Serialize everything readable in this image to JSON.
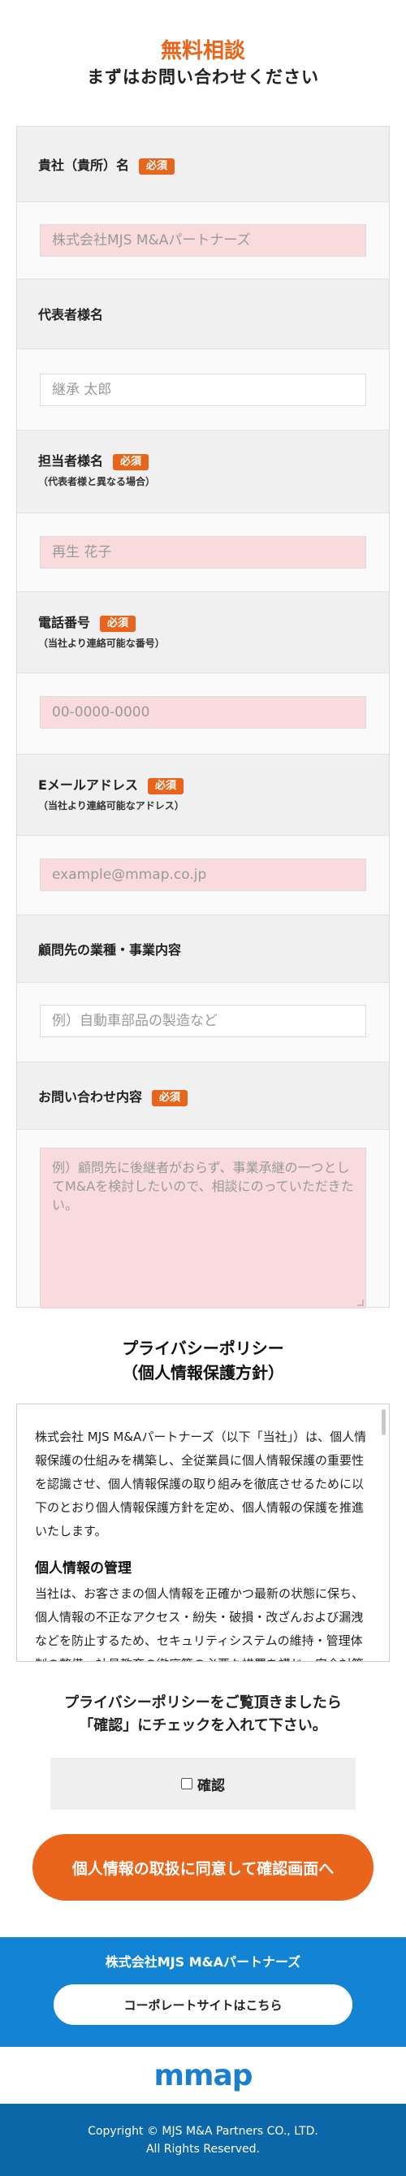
{
  "header": {
    "title": "無料相談",
    "subtitle": "まずはお問い合わせください"
  },
  "required_label": "必須",
  "form": {
    "company": {
      "label": "貴社（貴所）名",
      "placeholder": "株式会社MJS M&Aパートナーズ"
    },
    "representative": {
      "label": "代表者様名",
      "placeholder": "継承 太郎"
    },
    "contact_person": {
      "label": "担当者様名",
      "sublabel": "（代表者様と異なる場合）",
      "placeholder": "再生 花子"
    },
    "phone": {
      "label": "電話番号",
      "sublabel": "（当社より連絡可能な番号）",
      "placeholder": "00-0000-0000"
    },
    "email": {
      "label": "Eメールアドレス",
      "sublabel": "（当社より連絡可能なアドレス）",
      "placeholder": "example@mmap.co.jp"
    },
    "industry": {
      "label": "顧問先の業種・事業内容",
      "placeholder": "例）自動車部品の製造など"
    },
    "inquiry": {
      "label": "お問い合わせ内容",
      "placeholder": "例）顧問先に後継者がおらず、事業承継の一つとしてM&Aを検討したいので、相談にのっていただきたい。"
    }
  },
  "privacy": {
    "title_line1": "プライバシーポリシー",
    "title_line2": "（個人情報保護方針）",
    "intro": "株式会社 MJS M&Aパートナーズ（以下「当社」）は、個人情報保護の仕組みを構築し、全従業員に個人情報保護の重要性を認識させ、個人情報保護の取り組みを徹底させるために以下のとおり個人情報保護方針を定め、個人情報の保護を推進いたします。",
    "section_heading": "個人情報の管理",
    "section_text": "当社は、お客さまの個人情報を正確かつ最新の状態に保ち、個人情報の不正なアクセス・紛失・破損・改ざんおよび漏洩などを防止するため、セキュリティシステムの維持・管理体制の整備・社員教育の徹底等の必要な措置を講じ、安全対策を実施し個人情報の厳重な管理を行ないます。"
  },
  "consent": {
    "note_line1": "プライバシーポリシーをご覧頂きましたら",
    "note_line2": "「確認」にチェックを入れて下さい。",
    "checkbox_label": "確認",
    "submit_label": "個人情報の取扱に同意して確認画面へ"
  },
  "corporate": {
    "company_name": "株式会社MJS M&Aパートナーズ",
    "site_button": "コーポレートサイトはこちら"
  },
  "logo": {
    "text": "mmap"
  },
  "footer": {
    "copyright_line1": "Copyright © MJS M&A Partners CO., LTD.",
    "copyright_line2": "All Rights Reserved."
  },
  "colors": {
    "accent": "#e8651b",
    "field_pink": "#fadbdd",
    "corporate_blue": "#1384d4",
    "footer_blue": "#0c67a9"
  }
}
